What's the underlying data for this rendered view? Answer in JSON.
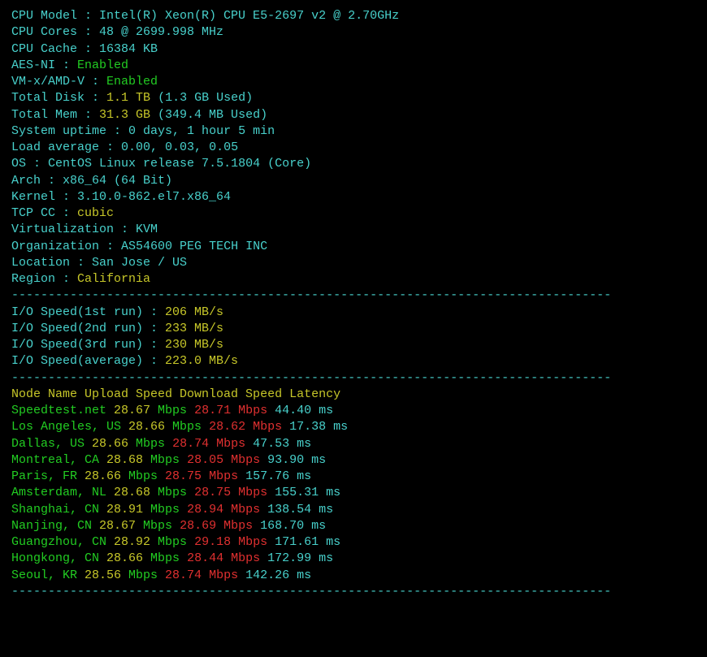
{
  "info": [
    {
      "k": "CPU Model",
      "v": [
        {
          "t": "Intel(R) Xeon(R) CPU E5-2697 v2 @ 2.70GHz",
          "c": "cyan"
        }
      ]
    },
    {
      "k": "CPU Cores",
      "v": [
        {
          "t": "48 @ 2699.998 MHz",
          "c": "cyan"
        }
      ]
    },
    {
      "k": "CPU Cache",
      "v": [
        {
          "t": "16384 KB",
          "c": "cyan"
        }
      ]
    },
    {
      "k": "AES-NI",
      "v": [
        {
          "t": "Enabled",
          "c": "green"
        }
      ]
    },
    {
      "k": "VM-x/AMD-V",
      "v": [
        {
          "t": "Enabled",
          "c": "green"
        }
      ]
    },
    {
      "k": "Total Disk",
      "v": [
        {
          "t": "1.1 TB ",
          "c": "yellow"
        },
        {
          "t": "(1.3 GB Used)",
          "c": "cyan"
        }
      ]
    },
    {
      "k": "Total Mem",
      "v": [
        {
          "t": "31.3 GB ",
          "c": "yellow"
        },
        {
          "t": "(349.4 MB Used)",
          "c": "cyan"
        }
      ]
    },
    {
      "k": "System uptime",
      "v": [
        {
          "t": "0 days, 1 hour 5 min",
          "c": "cyan"
        }
      ]
    },
    {
      "k": "Load average",
      "v": [
        {
          "t": "0.00, 0.03, 0.05",
          "c": "cyan"
        }
      ]
    },
    {
      "k": "OS",
      "v": [
        {
          "t": "CentOS Linux release 7.5.1804 (Core)",
          "c": "cyan"
        }
      ]
    },
    {
      "k": "Arch",
      "v": [
        {
          "t": "x86_64 (64 Bit)",
          "c": "cyan"
        }
      ]
    },
    {
      "k": "Kernel",
      "v": [
        {
          "t": "3.10.0-862.el7.x86_64",
          "c": "cyan"
        }
      ]
    },
    {
      "k": "TCP CC",
      "v": [
        {
          "t": "cubic",
          "c": "yellow"
        }
      ]
    },
    {
      "k": "Virtualization",
      "v": [
        {
          "t": "KVM",
          "c": "cyan"
        }
      ]
    },
    {
      "k": "Organization",
      "v": [
        {
          "t": "AS54600 PEG TECH INC",
          "c": "cyan"
        }
      ]
    },
    {
      "k": "Location",
      "v": [
        {
          "t": "San Jose / US",
          "c": "cyan"
        }
      ]
    },
    {
      "k": "Region",
      "v": [
        {
          "t": "California",
          "c": "yellow"
        }
      ]
    }
  ],
  "io": [
    {
      "k": "I/O Speed(1st run)",
      "v": "206 MB/s"
    },
    {
      "k": "I/O Speed(2nd run)",
      "v": "233 MB/s"
    },
    {
      "k": "I/O Speed(3rd run)",
      "v": "230 MB/s"
    },
    {
      "k": "I/O Speed(average)",
      "v": "223.0 MB/s"
    }
  ],
  "speedHeader": {
    "c1": "Node Name",
    "c2": "Upload Speed",
    "c3": "Download Speed",
    "c4": "Latency"
  },
  "speed": [
    {
      "name": "Speedtest.net",
      "up": "28.67",
      "dn": "28.71",
      "lat": "44.40"
    },
    {
      "name": "Los Angeles, US",
      "up": "28.66",
      "dn": "28.62",
      "lat": "17.38"
    },
    {
      "name": "Dallas, US",
      "up": "28.66",
      "dn": "28.74",
      "lat": "47.53"
    },
    {
      "name": "Montreal, CA",
      "up": "28.68",
      "dn": "28.05",
      "lat": "93.90"
    },
    {
      "name": "Paris, FR",
      "up": "28.66",
      "dn": "28.75",
      "lat": "157.76"
    },
    {
      "name": "Amsterdam, NL",
      "up": "28.68",
      "dn": "28.75",
      "lat": "155.31"
    },
    {
      "name": "Shanghai, CN",
      "up": "28.91",
      "dn": "28.94",
      "lat": "138.54"
    },
    {
      "name": "Nanjing, CN",
      "up": "28.67",
      "dn": "28.69",
      "lat": "168.70"
    },
    {
      "name": "Guangzhou, CN",
      "up": "28.92",
      "dn": "29.18",
      "lat": "171.61"
    },
    {
      "name": "Hongkong, CN",
      "up": "28.66",
      "dn": "28.44",
      "lat": "172.99"
    },
    {
      "name": "Seoul, KR",
      "up": "28.56",
      "dn": "28.74",
      "lat": "142.26"
    }
  ],
  "units": {
    "mbps": "Mbps",
    "ms": "ms"
  },
  "dash": "----------------------------------------------------------------------------------"
}
